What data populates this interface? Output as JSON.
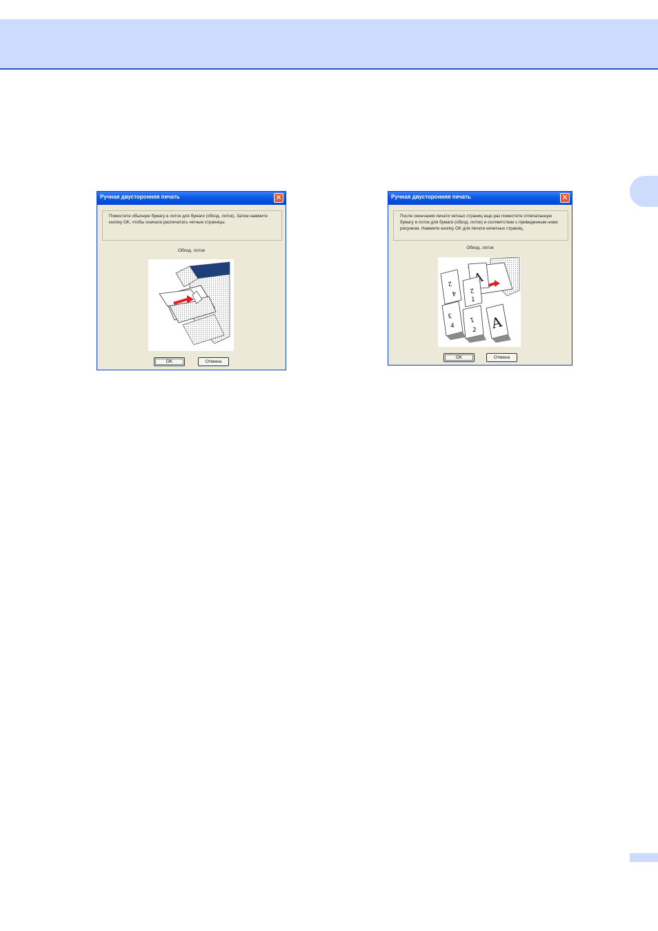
{
  "dialogs": [
    {
      "title": "Ручная двусторонняя печать",
      "message": "Поместите обычную бумагу в лоток для бумаги (обход. лоток). Затем нажмите кнопку OK, чтобы сначала распечатать четные страницы.",
      "image_label": "Обход. лоток",
      "ok_label": "OK",
      "cancel_label": "Отмена",
      "close_icon": "close-icon"
    },
    {
      "title": "Ручная двусторонняя печать",
      "message": "После окончания печати четных страниц еще раз поместите отпечатанную бумагу в лоток для бумаги (обход. лоток) в соответствии с приведенным ниже рисунком. Нажмите кнопку OK для печати нечетных страниц.",
      "image_label": "Обход. лоток",
      "ok_label": "OK",
      "cancel_label": "Отмена",
      "close_icon": "close-icon"
    }
  ],
  "colors": {
    "header_band": "#cddcfd",
    "header_rule": "#2a56c0",
    "dialog_bg": "#ece9d8",
    "titlebar": "#0a5ae6",
    "close_button": "#e25a3a",
    "arrow": "#e02020"
  }
}
